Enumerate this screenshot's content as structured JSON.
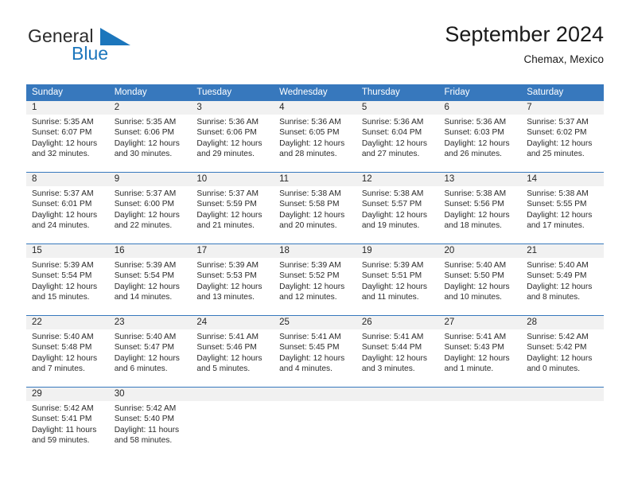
{
  "brand": {
    "name_part1": "General",
    "name_part2": "Blue",
    "mark_icon": "blue-flag-triangle-icon",
    "color_primary": "#1c76bc",
    "color_text": "#2b2b2b"
  },
  "header": {
    "title": "September 2024",
    "subtitle": "Chemax, Mexico"
  },
  "theme": {
    "header_bg": "#3778bd",
    "header_text": "#ffffff",
    "daynum_bg": "#f1f1f1",
    "rule_color": "#3778bd",
    "body_text": "#2a2a2a"
  },
  "calendar": {
    "weekday_headers": [
      "Sunday",
      "Monday",
      "Tuesday",
      "Wednesday",
      "Thursday",
      "Friday",
      "Saturday"
    ],
    "labels": {
      "sunrise": "Sunrise:",
      "sunset": "Sunset:",
      "daylight": "Daylight:"
    },
    "weeks": [
      [
        {
          "day": "1",
          "sunrise": "Sunrise: 5:35 AM",
          "sunset": "Sunset: 6:07 PM",
          "daylight_l1": "Daylight: 12 hours",
          "daylight_l2": "and 32 minutes."
        },
        {
          "day": "2",
          "sunrise": "Sunrise: 5:35 AM",
          "sunset": "Sunset: 6:06 PM",
          "daylight_l1": "Daylight: 12 hours",
          "daylight_l2": "and 30 minutes."
        },
        {
          "day": "3",
          "sunrise": "Sunrise: 5:36 AM",
          "sunset": "Sunset: 6:06 PM",
          "daylight_l1": "Daylight: 12 hours",
          "daylight_l2": "and 29 minutes."
        },
        {
          "day": "4",
          "sunrise": "Sunrise: 5:36 AM",
          "sunset": "Sunset: 6:05 PM",
          "daylight_l1": "Daylight: 12 hours",
          "daylight_l2": "and 28 minutes."
        },
        {
          "day": "5",
          "sunrise": "Sunrise: 5:36 AM",
          "sunset": "Sunset: 6:04 PM",
          "daylight_l1": "Daylight: 12 hours",
          "daylight_l2": "and 27 minutes."
        },
        {
          "day": "6",
          "sunrise": "Sunrise: 5:36 AM",
          "sunset": "Sunset: 6:03 PM",
          "daylight_l1": "Daylight: 12 hours",
          "daylight_l2": "and 26 minutes."
        },
        {
          "day": "7",
          "sunrise": "Sunrise: 5:37 AM",
          "sunset": "Sunset: 6:02 PM",
          "daylight_l1": "Daylight: 12 hours",
          "daylight_l2": "and 25 minutes."
        }
      ],
      [
        {
          "day": "8",
          "sunrise": "Sunrise: 5:37 AM",
          "sunset": "Sunset: 6:01 PM",
          "daylight_l1": "Daylight: 12 hours",
          "daylight_l2": "and 24 minutes."
        },
        {
          "day": "9",
          "sunrise": "Sunrise: 5:37 AM",
          "sunset": "Sunset: 6:00 PM",
          "daylight_l1": "Daylight: 12 hours",
          "daylight_l2": "and 22 minutes."
        },
        {
          "day": "10",
          "sunrise": "Sunrise: 5:37 AM",
          "sunset": "Sunset: 5:59 PM",
          "daylight_l1": "Daylight: 12 hours",
          "daylight_l2": "and 21 minutes."
        },
        {
          "day": "11",
          "sunrise": "Sunrise: 5:38 AM",
          "sunset": "Sunset: 5:58 PM",
          "daylight_l1": "Daylight: 12 hours",
          "daylight_l2": "and 20 minutes."
        },
        {
          "day": "12",
          "sunrise": "Sunrise: 5:38 AM",
          "sunset": "Sunset: 5:57 PM",
          "daylight_l1": "Daylight: 12 hours",
          "daylight_l2": "and 19 minutes."
        },
        {
          "day": "13",
          "sunrise": "Sunrise: 5:38 AM",
          "sunset": "Sunset: 5:56 PM",
          "daylight_l1": "Daylight: 12 hours",
          "daylight_l2": "and 18 minutes."
        },
        {
          "day": "14",
          "sunrise": "Sunrise: 5:38 AM",
          "sunset": "Sunset: 5:55 PM",
          "daylight_l1": "Daylight: 12 hours",
          "daylight_l2": "and 17 minutes."
        }
      ],
      [
        {
          "day": "15",
          "sunrise": "Sunrise: 5:39 AM",
          "sunset": "Sunset: 5:54 PM",
          "daylight_l1": "Daylight: 12 hours",
          "daylight_l2": "and 15 minutes."
        },
        {
          "day": "16",
          "sunrise": "Sunrise: 5:39 AM",
          "sunset": "Sunset: 5:54 PM",
          "daylight_l1": "Daylight: 12 hours",
          "daylight_l2": "and 14 minutes."
        },
        {
          "day": "17",
          "sunrise": "Sunrise: 5:39 AM",
          "sunset": "Sunset: 5:53 PM",
          "daylight_l1": "Daylight: 12 hours",
          "daylight_l2": "and 13 minutes."
        },
        {
          "day": "18",
          "sunrise": "Sunrise: 5:39 AM",
          "sunset": "Sunset: 5:52 PM",
          "daylight_l1": "Daylight: 12 hours",
          "daylight_l2": "and 12 minutes."
        },
        {
          "day": "19",
          "sunrise": "Sunrise: 5:39 AM",
          "sunset": "Sunset: 5:51 PM",
          "daylight_l1": "Daylight: 12 hours",
          "daylight_l2": "and 11 minutes."
        },
        {
          "day": "20",
          "sunrise": "Sunrise: 5:40 AM",
          "sunset": "Sunset: 5:50 PM",
          "daylight_l1": "Daylight: 12 hours",
          "daylight_l2": "and 10 minutes."
        },
        {
          "day": "21",
          "sunrise": "Sunrise: 5:40 AM",
          "sunset": "Sunset: 5:49 PM",
          "daylight_l1": "Daylight: 12 hours",
          "daylight_l2": "and 8 minutes."
        }
      ],
      [
        {
          "day": "22",
          "sunrise": "Sunrise: 5:40 AM",
          "sunset": "Sunset: 5:48 PM",
          "daylight_l1": "Daylight: 12 hours",
          "daylight_l2": "and 7 minutes."
        },
        {
          "day": "23",
          "sunrise": "Sunrise: 5:40 AM",
          "sunset": "Sunset: 5:47 PM",
          "daylight_l1": "Daylight: 12 hours",
          "daylight_l2": "and 6 minutes."
        },
        {
          "day": "24",
          "sunrise": "Sunrise: 5:41 AM",
          "sunset": "Sunset: 5:46 PM",
          "daylight_l1": "Daylight: 12 hours",
          "daylight_l2": "and 5 minutes."
        },
        {
          "day": "25",
          "sunrise": "Sunrise: 5:41 AM",
          "sunset": "Sunset: 5:45 PM",
          "daylight_l1": "Daylight: 12 hours",
          "daylight_l2": "and 4 minutes."
        },
        {
          "day": "26",
          "sunrise": "Sunrise: 5:41 AM",
          "sunset": "Sunset: 5:44 PM",
          "daylight_l1": "Daylight: 12 hours",
          "daylight_l2": "and 3 minutes."
        },
        {
          "day": "27",
          "sunrise": "Sunrise: 5:41 AM",
          "sunset": "Sunset: 5:43 PM",
          "daylight_l1": "Daylight: 12 hours",
          "daylight_l2": "and 1 minute."
        },
        {
          "day": "28",
          "sunrise": "Sunrise: 5:42 AM",
          "sunset": "Sunset: 5:42 PM",
          "daylight_l1": "Daylight: 12 hours",
          "daylight_l2": "and 0 minutes."
        }
      ],
      [
        {
          "day": "29",
          "sunrise": "Sunrise: 5:42 AM",
          "sunset": "Sunset: 5:41 PM",
          "daylight_l1": "Daylight: 11 hours",
          "daylight_l2": "and 59 minutes."
        },
        {
          "day": "30",
          "sunrise": "Sunrise: 5:42 AM",
          "sunset": "Sunset: 5:40 PM",
          "daylight_l1": "Daylight: 11 hours",
          "daylight_l2": "and 58 minutes."
        },
        {
          "day": "",
          "sunrise": "",
          "sunset": "",
          "daylight_l1": "",
          "daylight_l2": ""
        },
        {
          "day": "",
          "sunrise": "",
          "sunset": "",
          "daylight_l1": "",
          "daylight_l2": ""
        },
        {
          "day": "",
          "sunrise": "",
          "sunset": "",
          "daylight_l1": "",
          "daylight_l2": ""
        },
        {
          "day": "",
          "sunrise": "",
          "sunset": "",
          "daylight_l1": "",
          "daylight_l2": ""
        },
        {
          "day": "",
          "sunrise": "",
          "sunset": "",
          "daylight_l1": "",
          "daylight_l2": ""
        }
      ]
    ]
  }
}
